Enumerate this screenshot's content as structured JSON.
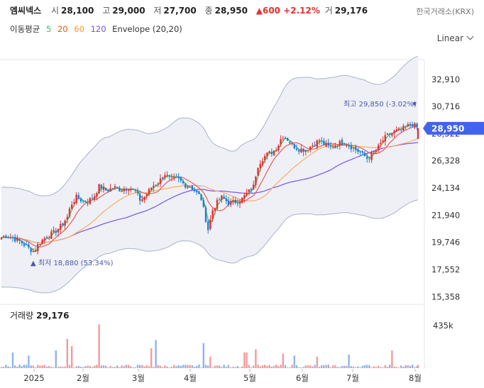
{
  "header": {
    "name": "엠씨넥스",
    "open_label": "시",
    "open": "28,100",
    "high_label": "고",
    "high": "29,000",
    "low_label": "저",
    "low": "27,700",
    "close_label": "종",
    "close": "28,950",
    "change": "▲600 +2.12%",
    "vol_label": "거",
    "volume": "29,176",
    "exchange": "한국거래소(KRX)"
  },
  "indicators": {
    "label": "이동평균",
    "ma5": "5",
    "ma20": "20",
    "ma60": "60",
    "ma120": "120",
    "envelope": "Envelope (20,20)"
  },
  "scale_selector": "Linear",
  "volume_panel": {
    "title": "거래량",
    "value": "29,176",
    "axis_label": "435k"
  },
  "colors": {
    "up": "#e03131",
    "down": "#1c7ed6",
    "ma5": "#40c057",
    "ma20": "#e8590c",
    "ma60": "#fd7e14",
    "ma120": "#7950f2",
    "price_tag": "#4263eb",
    "envelope_fill": "#eef0f6"
  },
  "chart_data": {
    "type": "candlestick",
    "y_ticks": [
      "32,910",
      "30,716",
      "28,522",
      "26,328",
      "24,134",
      "21,940",
      "19,746",
      "17,552",
      "15,358"
    ],
    "y_tick_values": [
      32910,
      30716,
      28522,
      26328,
      24134,
      21940,
      19746,
      17552,
      15358
    ],
    "ylim": [
      14800,
      34500
    ],
    "x_ticks": [
      "2025",
      "2월",
      "3월",
      "4월",
      "5월",
      "6월",
      "7월",
      "8월"
    ],
    "current_price_tag": "28,950",
    "current_price": 28950,
    "high_annotation": "최고 29,850 (-3.02%)",
    "high_value": 29850,
    "low_annotation": "▲ 최저 18,880 (53.34%)",
    "low_value": 18880,
    "price_anchors": [
      [
        0,
        20100
      ],
      [
        10,
        20300
      ],
      [
        20,
        20050
      ],
      [
        30,
        19750
      ],
      [
        42,
        19200
      ],
      [
        48,
        19000
      ],
      [
        55,
        19700
      ],
      [
        65,
        20200
      ],
      [
        75,
        20500
      ],
      [
        85,
        21000
      ],
      [
        95,
        21800
      ],
      [
        100,
        22800
      ],
      [
        108,
        23400
      ],
      [
        118,
        23000
      ],
      [
        125,
        23100
      ],
      [
        133,
        23500
      ],
      [
        140,
        24300
      ],
      [
        150,
        23900
      ],
      [
        160,
        24200
      ],
      [
        170,
        24000
      ],
      [
        180,
        24200
      ],
      [
        190,
        23900
      ],
      [
        198,
        23100
      ],
      [
        205,
        23500
      ],
      [
        215,
        24300
      ],
      [
        225,
        24700
      ],
      [
        232,
        25300
      ],
      [
        240,
        24800
      ],
      [
        250,
        24900
      ],
      [
        260,
        24400
      ],
      [
        268,
        24300
      ],
      [
        276,
        23800
      ],
      [
        283,
        23400
      ],
      [
        290,
        21600
      ],
      [
        294,
        20600
      ],
      [
        298,
        22200
      ],
      [
        305,
        22900
      ],
      [
        313,
        23400
      ],
      [
        322,
        22900
      ],
      [
        330,
        23000
      ],
      [
        340,
        23200
      ],
      [
        350,
        23800
      ],
      [
        358,
        24300
      ],
      [
        362,
        25800
      ],
      [
        368,
        26400
      ],
      [
        375,
        26800
      ],
      [
        385,
        27100
      ],
      [
        392,
        27600
      ],
      [
        398,
        28400
      ],
      [
        405,
        28100
      ],
      [
        412,
        27600
      ],
      [
        420,
        27300
      ],
      [
        430,
        27200
      ],
      [
        440,
        27600
      ],
      [
        450,
        28000
      ],
      [
        458,
        27600
      ],
      [
        466,
        27400
      ],
      [
        476,
        27700
      ],
      [
        486,
        27900
      ],
      [
        494,
        27500
      ],
      [
        502,
        27200
      ],
      [
        510,
        26900
      ],
      [
        518,
        26500
      ],
      [
        525,
        26900
      ],
      [
        533,
        27400
      ],
      [
        541,
        28100
      ],
      [
        549,
        28500
      ],
      [
        557,
        28700
      ],
      [
        565,
        28800
      ],
      [
        573,
        29100
      ],
      [
        581,
        29300
      ],
      [
        589,
        28950
      ]
    ],
    "volume_tallest": 435000,
    "volume_spikes": [
      [
        17,
        150000
      ],
      [
        39,
        120000
      ],
      [
        80,
        170000
      ],
      [
        95,
        280000
      ],
      [
        100,
        210000
      ],
      [
        141,
        420000
      ],
      [
        214,
        190000
      ],
      [
        220,
        270000
      ],
      [
        286,
        240000
      ],
      [
        296,
        110000
      ],
      [
        346,
        150000
      ],
      [
        360,
        180000
      ],
      [
        400,
        140000
      ],
      [
        414,
        120000
      ],
      [
        446,
        110000
      ],
      [
        492,
        130000
      ],
      [
        553,
        170000
      ]
    ]
  }
}
